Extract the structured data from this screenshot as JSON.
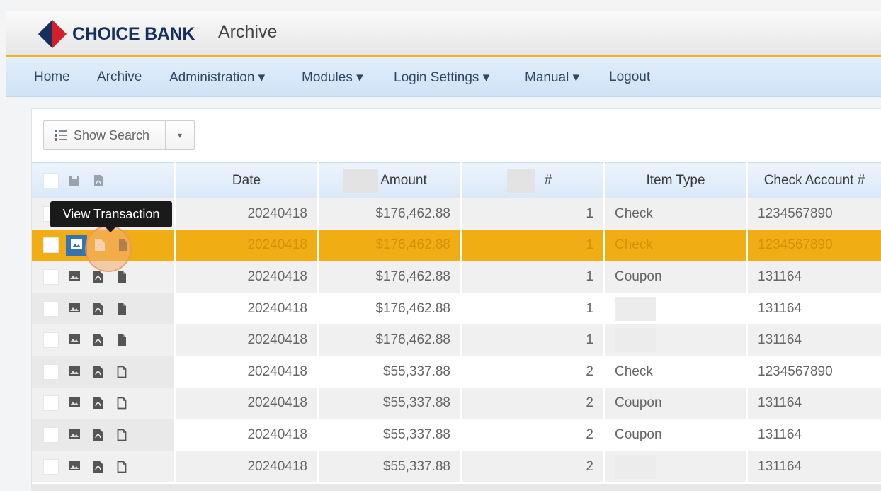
{
  "header": {
    "brand": "CHOICE BANK",
    "title": "Archive",
    "colors": {
      "accent": "#f0b31f",
      "brand": "#15305f",
      "logo_red": "#d21f2b"
    }
  },
  "nav": {
    "items": [
      {
        "label": "Home"
      },
      {
        "label": "Archive"
      },
      {
        "label": "Administration ▾"
      },
      {
        "label": "Modules ▾"
      },
      {
        "label": "Login Settings ▾"
      },
      {
        "label": "Manual ▾"
      },
      {
        "label": "Logout"
      }
    ]
  },
  "toolbar": {
    "search_label": "Show Search",
    "caret": "▾",
    "search_icon": "list-icon"
  },
  "table": {
    "columns": {
      "date": "Date",
      "amount": "Amount",
      "number": "#",
      "item_type": "Item Type",
      "check_account": "Check Account #"
    },
    "rows": [
      {
        "date": "20240418",
        "amount": "$176,462.88",
        "number": "1",
        "item_type": "Check",
        "account": "1234567890"
      },
      {
        "date": "20240418",
        "amount": "$176,462.88",
        "number": "1",
        "item_type": "Check",
        "account": "1234567890",
        "selected": true
      },
      {
        "date": "20240418",
        "amount": "$176,462.88",
        "number": "1",
        "item_type": "Coupon",
        "account": "131164"
      },
      {
        "date": "20240418",
        "amount": "$176,462.88",
        "number": "1",
        "item_type": "",
        "account": "131164"
      },
      {
        "date": "20240418",
        "amount": "$176,462.88",
        "number": "1",
        "item_type": "",
        "account": "131164"
      },
      {
        "date": "20240418",
        "amount": "$55,337.88",
        "number": "2",
        "item_type": "Check",
        "account": "1234567890"
      },
      {
        "date": "20240418",
        "amount": "$55,337.88",
        "number": "2",
        "item_type": "Coupon",
        "account": "131164"
      },
      {
        "date": "20240418",
        "amount": "$55,337.88",
        "number": "2",
        "item_type": "Coupon",
        "account": "131164"
      },
      {
        "date": "20240418",
        "amount": "$55,337.88",
        "number": "2",
        "item_type": "",
        "account": "131164"
      }
    ]
  },
  "tooltip": {
    "text": "View Transaction"
  },
  "colors": {
    "selected_row": "#f0ae14",
    "header_row": "#d9e8f8",
    "view_button": "#3574b4"
  }
}
